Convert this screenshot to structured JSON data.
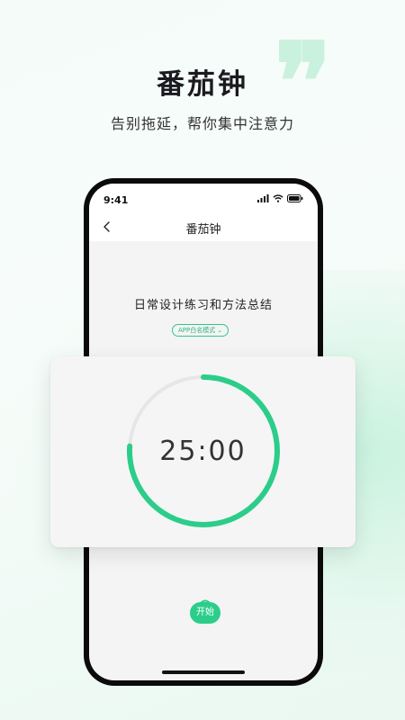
{
  "hero": {
    "title": "番茄钟",
    "subtitle": "告别拖延，帮你集中注意力",
    "quote_mark": "❞"
  },
  "status_bar": {
    "time": "9:41"
  },
  "nav": {
    "title": "番茄钟"
  },
  "task": {
    "title": "日常设计练习和方法总结"
  },
  "mode": {
    "label": "APP白名模式",
    "chevron": "⌄"
  },
  "timer": {
    "display": "25:00",
    "progress_fraction": 0.76
  },
  "start_button": {
    "label": "开始"
  },
  "colors": {
    "accent": "#2ccd8a",
    "ring_track": "#e6e6e6"
  },
  "icons": {
    "back": "back-icon",
    "signal": "signal-icon",
    "wifi": "wifi-icon",
    "battery": "battery-icon",
    "tomato_leaf": "leaf-icon"
  }
}
